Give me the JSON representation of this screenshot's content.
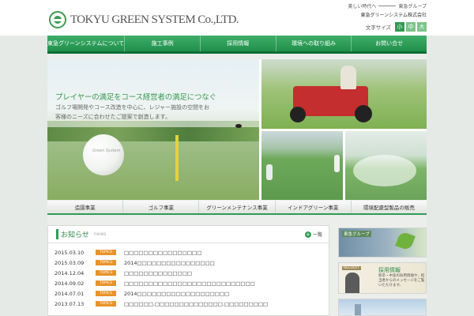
{
  "header": {
    "logo_text": "TOKYU GREEN SYSTEM Co.,LTD.",
    "tagline_left": "美しい時代へ",
    "tagline_right": "東急グループ",
    "company_name": "東急グリーンシステム株式会社",
    "font_size": {
      "label": "文字サイズ",
      "options": [
        "小",
        "中",
        "大"
      ],
      "active": "小"
    }
  },
  "nav": {
    "items": [
      "東急グリーンシステムについて",
      "施工事例",
      "採用情報",
      "環境への取り組み",
      "お問い合せ"
    ]
  },
  "hero": {
    "title": "プレイヤーの満足をコース経営者の満足につなぐ",
    "subtitle": "ゴルフ場開発やコース改造を中心に、レジャー施設の空間をお客様のニーズに合わせたご提案で創造します。"
  },
  "categories": [
    "造園事業",
    "ゴルフ事業",
    "グリーンメンテナンス事業",
    "インドアグリーン事業",
    "環境配慮型製品の販売"
  ],
  "news": {
    "title": "お知らせ",
    "title_en": "news",
    "all_label": "一覧",
    "items": [
      {
        "date": "2015.03.10",
        "tag": "TOPICS",
        "text": "□□□□□□□□□□□□□□□□"
      },
      {
        "date": "2015.03.09",
        "tag": "TOPICS",
        "text": "2014□□□□□□□□□□□□□□□□"
      },
      {
        "date": "2014.12.04",
        "tag": "TOPICS",
        "text": "□□□□□□□□□□□□□□"
      },
      {
        "date": "2014.09.02",
        "tag": "TOPICS",
        "text": "□□□□□□□□□□□□□□□□□□□□□□□□□□□"
      },
      {
        "date": "2014.07.01",
        "tag": "TOPICS",
        "text": "2014□□□□□□□□□□□□□□□□□□□"
      },
      {
        "date": "2013.07.13",
        "tag": "TOPICS",
        "text": "□□□□□□.□□□□□□□□□□□□□□.□□□□□□□□□"
      }
    ]
  },
  "side": {
    "banner1_label": "東急グループ",
    "banner2_tag": "RECRUIT",
    "banner2_title": "採用情報",
    "banner2_desc": "新卒・中途の採用情報や、担当者からのメッセージをご覧いただけます。"
  }
}
